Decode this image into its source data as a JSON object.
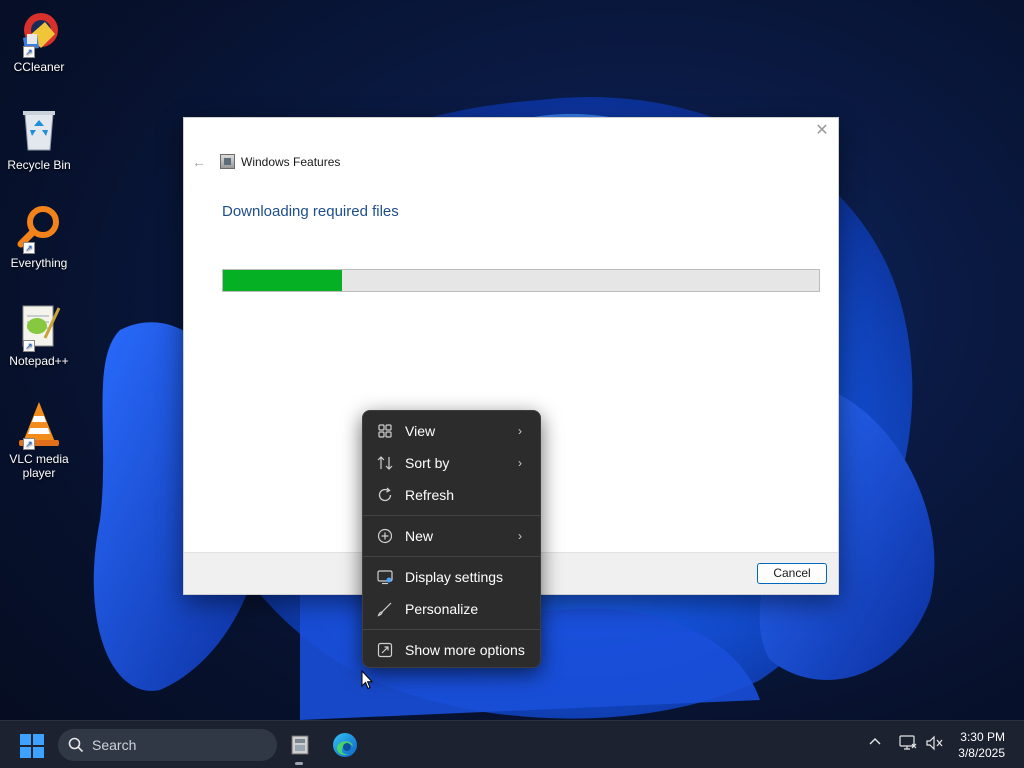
{
  "desktop": {
    "icons": [
      {
        "label": "CCleaner"
      },
      {
        "label": "Recycle Bin"
      },
      {
        "label": "Everything"
      },
      {
        "label": "Notepad++"
      },
      {
        "label": "VLC media player"
      }
    ]
  },
  "dialog": {
    "title": "Windows Features",
    "heading": "Downloading required files",
    "progress_fraction": 0.2,
    "cancel_label": "Cancel",
    "close_glyph": "✕",
    "back_glyph": "←"
  },
  "context_menu": {
    "items": [
      {
        "label": "View",
        "icon": "grid-icon",
        "submenu": true
      },
      {
        "label": "Sort by",
        "icon": "sort-icon",
        "submenu": true
      },
      {
        "label": "Refresh",
        "icon": "refresh-icon",
        "submenu": false
      },
      {
        "label": "New",
        "icon": "plus-circle-icon",
        "submenu": true
      },
      {
        "label": "Display settings",
        "icon": "display-icon",
        "submenu": false
      },
      {
        "label": "Personalize",
        "icon": "brush-icon",
        "submenu": false
      },
      {
        "label": "Show more options",
        "icon": "expand-icon",
        "submenu": false
      }
    ]
  },
  "taskbar": {
    "search_placeholder": "Search",
    "time": "3:30 PM",
    "date": "3/8/2025"
  },
  "colors": {
    "accent": "#0067c0",
    "progress_fill": "#06b025",
    "menu_bg": "#2c2c2c",
    "taskbar_bg": "#1c2230"
  }
}
